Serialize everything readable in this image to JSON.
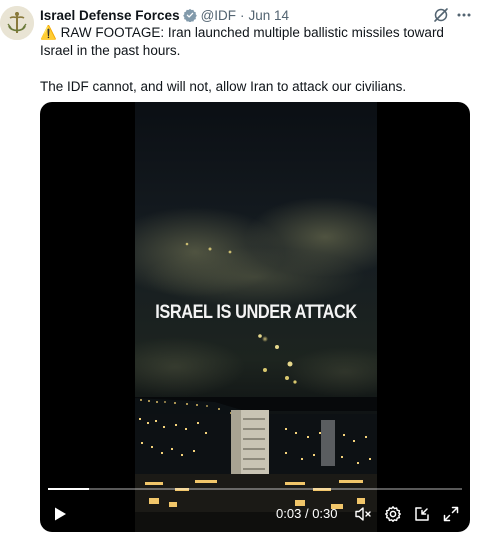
{
  "account": {
    "name": "Israel Defense Forces",
    "handle": "@IDF",
    "separator": "·",
    "date": "Jun 14",
    "verified_color": "#829aab"
  },
  "tweet": {
    "warning_icon": "⚠️",
    "line1": "RAW FOOTAGE: Iran launched multiple ballistic missiles toward Israel in the past hours.",
    "line2": "The IDF cannot, and will not, allow Iran to attack our civilians."
  },
  "video": {
    "overlay_text": "ISRAEL IS UNDER ATTACK",
    "current_time": "0:03",
    "time_separator": "/",
    "duration": "0:30",
    "progress": 0.1,
    "icons": [
      "play-icon",
      "volume-muted-icon",
      "settings-icon",
      "pip-icon",
      "fullscreen-icon"
    ]
  },
  "actions": {
    "grok_icon": "grok-icon",
    "more_icon": "more-icon"
  }
}
